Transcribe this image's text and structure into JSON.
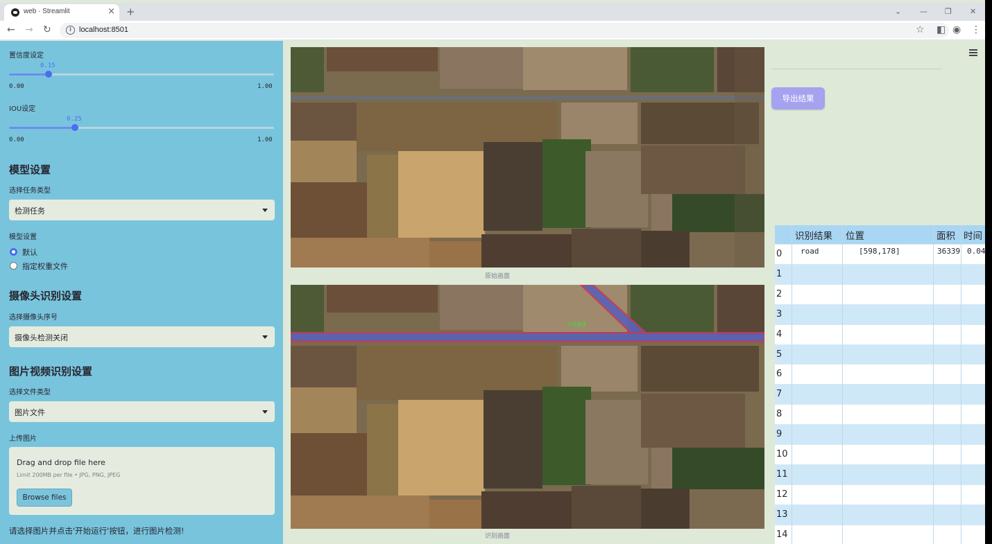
{
  "browser": {
    "tab_title": "web · Streamlit",
    "url": "localhost:8501"
  },
  "sidebar": {
    "confidence": {
      "label": "置信度设定",
      "value": "0.15",
      "value_num": 0.15,
      "min": "0.00",
      "max": "1.00"
    },
    "iou": {
      "label": "IOU设定",
      "value": "0.25",
      "value_num": 0.25,
      "min": "0.00",
      "max": "1.00"
    },
    "model_section": {
      "heading": "模型设置",
      "task_label": "选择任务类型",
      "task_value": "检测任务",
      "model_label": "模型设置",
      "options": [
        "默认",
        "指定权重文件"
      ],
      "selected": 0
    },
    "camera_section": {
      "heading": "摄像头识别设置",
      "camera_label": "选择摄像头序号",
      "camera_value": "摄像头检测关闭"
    },
    "media_section": {
      "heading": "图片视频识别设置",
      "file_type_label": "选择文件类型",
      "file_type_value": "图片文件",
      "upload_label": "上传图片",
      "drop_text": "Drag and drop file here",
      "limit_text": "Limit 200MB per file • JPG, PNG, JPEG",
      "browse_label": "Browse files"
    },
    "hint": "请选择图片并点击'开始运行'按钮，进行图片检测!"
  },
  "main": {
    "original_caption": "原始画面",
    "result_caption": "识别画面",
    "detection_label": "road",
    "export_label": "导出结果"
  },
  "table": {
    "headers": [
      "识别结果",
      "位置",
      "面积",
      "时间"
    ],
    "rows": [
      {
        "index": "0",
        "result": "road",
        "position": "[598,178]",
        "area": "36339",
        "time": "0.04"
      },
      {
        "index": "1"
      },
      {
        "index": "2"
      },
      {
        "index": "3"
      },
      {
        "index": "4"
      },
      {
        "index": "5"
      },
      {
        "index": "6"
      },
      {
        "index": "7"
      },
      {
        "index": "8"
      },
      {
        "index": "9"
      },
      {
        "index": "10"
      },
      {
        "index": "11"
      },
      {
        "index": "12"
      },
      {
        "index": "13"
      },
      {
        "index": "14"
      }
    ]
  },
  "colors": {
    "sidebar_bg": "#79c4dd",
    "main_bg": "#dfe9d8",
    "accent": "#4a6ef0",
    "export_button": "#a5a2f0",
    "table_header": "#a9d6f3",
    "table_row_alt": "#cfe8f8",
    "road_outline": "#d8344a",
    "road_fill": "#5a62b8",
    "label_green": "#3ddc3d"
  }
}
